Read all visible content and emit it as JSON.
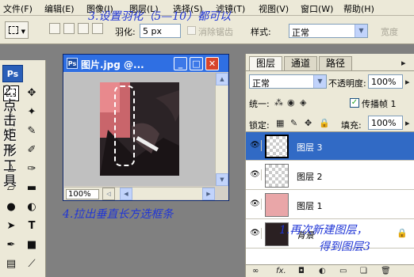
{
  "menu": [
    {
      "label": "文件",
      "key": "(F)"
    },
    {
      "label": "编辑",
      "key": "(E)"
    },
    {
      "label": "图像",
      "key": "(I)"
    },
    {
      "label": "图层",
      "key": "(L)"
    },
    {
      "label": "选择",
      "key": "(S)"
    },
    {
      "label": "滤镜",
      "key": "(T)"
    },
    {
      "label": "视图",
      "key": "(V)"
    },
    {
      "label": "窗口",
      "key": "(W)"
    },
    {
      "label": "帮助",
      "key": "(H)"
    }
  ],
  "options": {
    "feather_label": "羽化:",
    "feather_value": "5 px",
    "antialias_label": "消除锯齿",
    "style_label": "样式:",
    "style_value": "正常",
    "width_label": "宽度"
  },
  "annotations": {
    "a1": "3.设置羽化（5—10）都可以",
    "a2": "2.点击矩形工具",
    "a3": "4.拉出垂直长方选框条",
    "a4_line1": "1.再次新建图层，",
    "a4_line2": "得到图层3"
  },
  "document": {
    "title": "图片.jpg @...",
    "zoom": "100%"
  },
  "layers_panel": {
    "tabs": [
      "图层",
      "通道",
      "路径"
    ],
    "blend_mode": "正常",
    "opacity_label": "不透明度:",
    "opacity_value": "100%",
    "unify_label": "统一:",
    "propagate_label": "传播帧 1",
    "lock_label": "锁定:",
    "fill_label": "填充:",
    "fill_value": "100%",
    "layers": [
      {
        "name": "图层 3",
        "selected": true
      },
      {
        "name": "图层 2",
        "selected": false
      },
      {
        "name": "图层 1",
        "selected": false
      },
      {
        "name": "背景",
        "selected": false
      }
    ]
  },
  "colors": {
    "annotation": "#1f35d6",
    "selection": "#316ac5",
    "titlebar": "#2f6fe3"
  }
}
